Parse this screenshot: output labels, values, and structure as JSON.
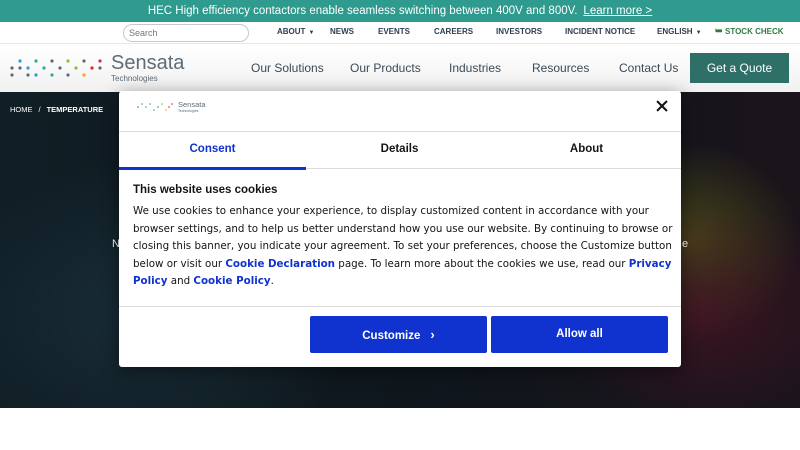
{
  "announcement": {
    "text": "HEC High efficiency contactors enable seamless switching between 400V and 800V.",
    "link": "Learn more >"
  },
  "utility_bar": {
    "search_placeholder": "Search",
    "items": [
      "ABOUT",
      "NEWS",
      "EVENTS",
      "CAREERS",
      "INVESTORS",
      "INCIDENT NOTICE",
      "ENGLISH",
      "STOCK CHECK"
    ]
  },
  "header": {
    "logo_text": "Sensata",
    "logo_subtext": "Technologies",
    "nav": [
      "Our Solutions",
      "Our Products",
      "Industries",
      "Resources",
      "Contact Us"
    ],
    "cta": "Get a Quote"
  },
  "breadcrumb": {
    "home": "HOME",
    "separator": "/",
    "current": "TEMPERATURE"
  },
  "hero": {
    "left_fragment": "N",
    "right_fragment": "e"
  },
  "cookie_modal": {
    "logo_text": "Sensata",
    "logo_subtext": "Technologies",
    "tabs": [
      "Consent",
      "Details",
      "About"
    ],
    "active_tab": "Consent",
    "title": "This website uses cookies",
    "body_part1": "We use cookies to enhance your experience, to display customized content in accordance with your browser settings, and to help us better understand how you use our website. By continuing to browse or closing this banner, you indicate your agreement. To set your preferences, choose the Customize button below or visit our ",
    "link_cookie_declaration": "Cookie Declaration",
    "body_part2": " page. To learn more about the cookies we use, read our ",
    "link_privacy_policy": "Privacy Policy",
    "body_part3": " and ",
    "link_cookie_policy": "Cookie Policy",
    "body_part4": ".",
    "customize_label": "Customize",
    "customize_chevron": "›",
    "allow_all_label": "Allow all"
  },
  "colors": {
    "announcement_bg": "#2f9a8e",
    "primary_blue": "#1032cf",
    "quote_button": "#2e7068",
    "stock_check": "#2f7d44"
  }
}
